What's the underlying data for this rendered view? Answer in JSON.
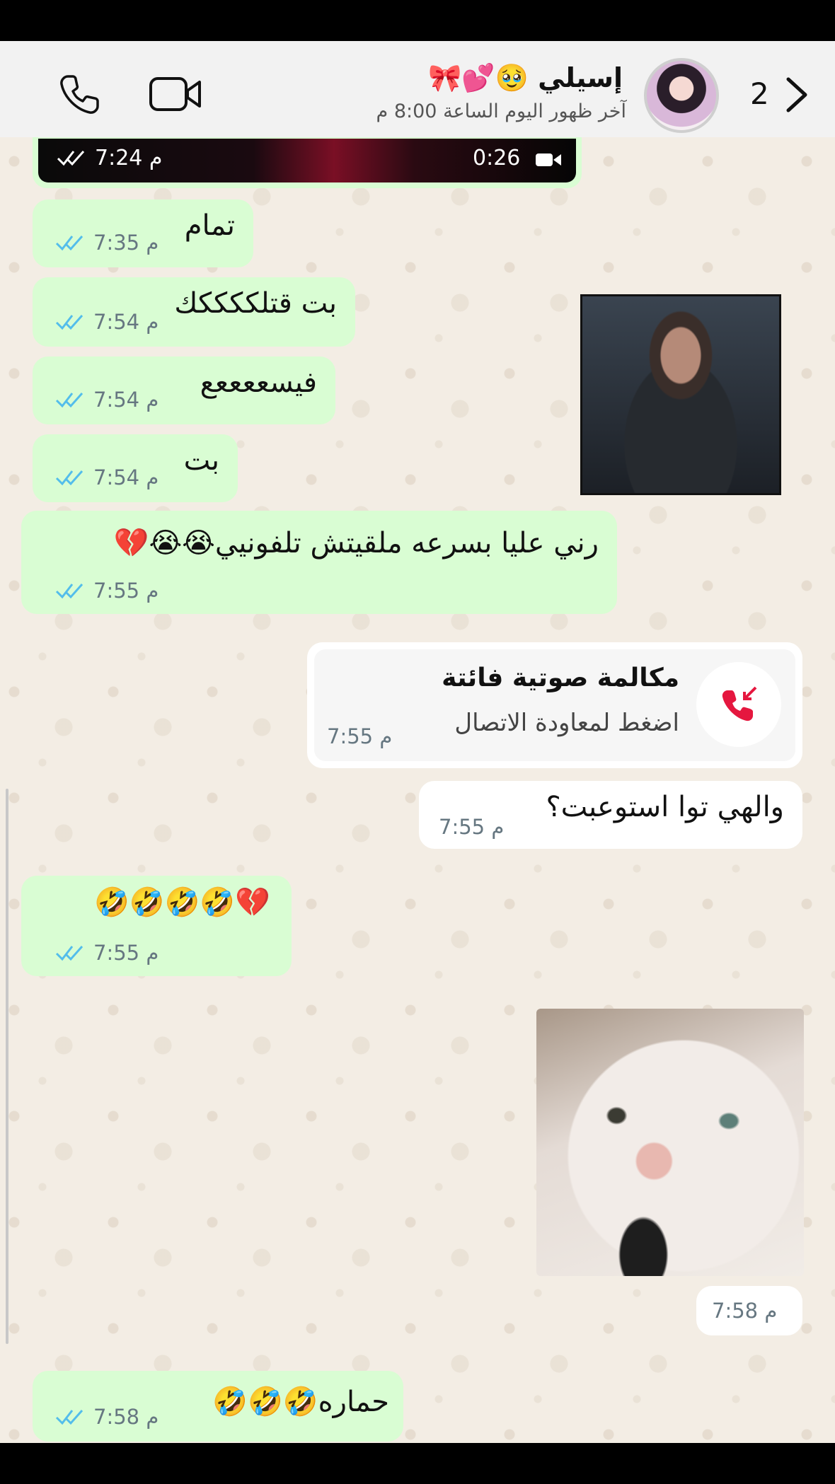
{
  "header": {
    "contact_name": "إسيلي 🥹💕🎀",
    "last_seen": "آخر ظهور اليوم الساعة 8:00 م",
    "unread_count": "2",
    "icons": [
      "call-icon",
      "video-call-icon",
      "chevron-right-icon"
    ]
  },
  "video_message": {
    "duration": "0:26",
    "time": "7:24 م"
  },
  "messages": [
    {
      "text": "تمام",
      "time": "7:35 م"
    },
    {
      "text": "بت قتلككككك",
      "time": "7:54 م"
    },
    {
      "text": "فيسععععع",
      "time": "7:54 م"
    },
    {
      "text": "بت",
      "time": "7:54 م"
    },
    {
      "text": "رني عليا بسرعه ملقيتش تلفونيي😭😭💔",
      "time": "7:55 م"
    },
    {
      "text": "💔🤣🤣🤣🤣",
      "time": "7:55 م"
    },
    {
      "text": "حماره🤣🤣🤣",
      "time": "7:58 م"
    }
  ],
  "missed_call": {
    "title": "مكالمة صوتية فائتة",
    "subtitle": "اضغط لمعاودة الاتصال",
    "time": "7:55 م"
  },
  "incoming": [
    {
      "text": "والهي توا استوعبت؟",
      "time": "7:55 م"
    }
  ],
  "photo_incoming_time": "7:58 م",
  "colors": {
    "outgoing_bubble": "#d9fdd3",
    "incoming_bubble": "#ffffff",
    "read_ticks": "#53bdeb",
    "missed_call_red": "#e5173f"
  }
}
